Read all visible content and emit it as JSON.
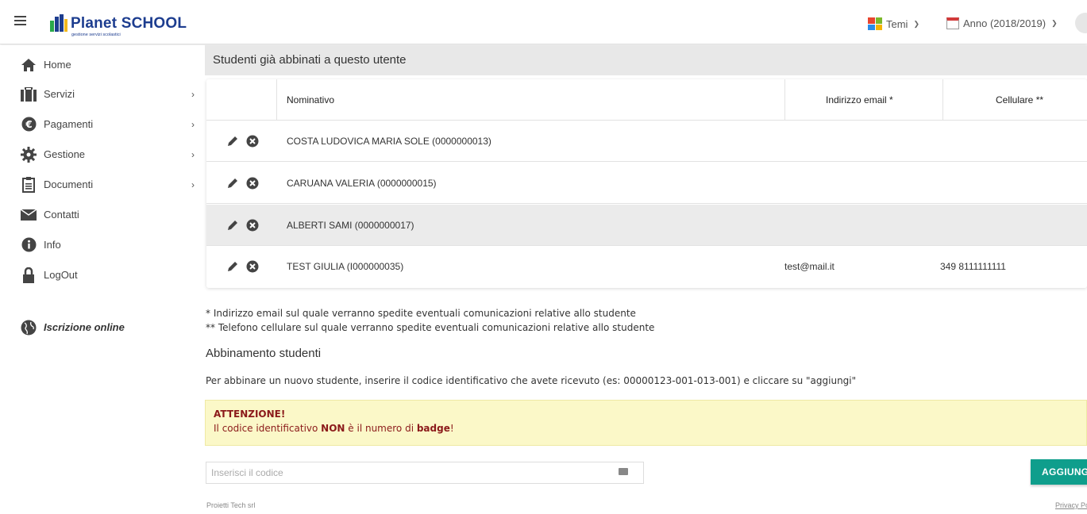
{
  "header": {
    "app_name": "Planet SCHOOL",
    "app_subtitle": "gestione servizi scolastici",
    "themes_label": "Temi",
    "year_label": "Anno (2018/2019)"
  },
  "sidebar": {
    "items": [
      {
        "label": "Home",
        "icon": "home-icon",
        "has_submenu": false
      },
      {
        "label": "Servizi",
        "icon": "briefcase-icon",
        "has_submenu": true
      },
      {
        "label": "Pagamenti",
        "icon": "euro-icon",
        "has_submenu": true
      },
      {
        "label": "Gestione",
        "icon": "gear-icon",
        "has_submenu": true
      },
      {
        "label": "Documenti",
        "icon": "clipboard-icon",
        "has_submenu": true
      },
      {
        "label": "Contatti",
        "icon": "envelope-icon",
        "has_submenu": false
      },
      {
        "label": "Info",
        "icon": "info-icon",
        "has_submenu": false
      },
      {
        "label": "LogOut",
        "icon": "lock-icon",
        "has_submenu": false
      }
    ],
    "online_label": "Iscrizione online"
  },
  "main": {
    "panel_title": "Studenti già abbinati a questo utente",
    "table": {
      "headers": [
        "Nominativo",
        "Indirizzo email *",
        "Cellulare **"
      ],
      "rows": [
        {
          "name": "COSTA LUDOVICA MARIA SOLE (0000000013)",
          "email": "",
          "phone": ""
        },
        {
          "name": "CARUANA VALERIA (0000000015)",
          "email": "",
          "phone": ""
        },
        {
          "name": "ALBERTI SAMI (0000000017)",
          "email": "",
          "phone": ""
        },
        {
          "name": "TEST GIULIA (I000000035)",
          "email": "test@mail.it",
          "phone": "349 8111111111"
        }
      ]
    },
    "note_email": "* Indirizzo email sul quale verranno spedite eventuali comunicazioni relative allo studente",
    "note_phone": "** Telefono cellulare sul quale verranno spedite eventuali comunicazioni relative allo studente",
    "section_title": "Abbinamento studenti",
    "instructions": "Per abbinare un nuovo studente, inserire il codice identificativo che avete ricevuto (es: 00000123-001-013-001) e cliccare su \"aggiungi\"",
    "warning": {
      "title": "ATTENZIONE!",
      "text_before": "Il codice identificativo ",
      "text_bold1": "NON",
      "text_middle": " è il numero di ",
      "text_bold2": "badge",
      "text_after": "!"
    },
    "code_placeholder": "Inserisci il codice",
    "add_button": "AGGIUNGI"
  },
  "footer": {
    "company": "Proietti Tech srl",
    "privacy": "Privacy Policy"
  },
  "colors": {
    "brand": "#1d3d8f",
    "button": "#0f9e8c",
    "warning_bg": "#fbf8c8",
    "warning_text": "#8b1a1a"
  }
}
